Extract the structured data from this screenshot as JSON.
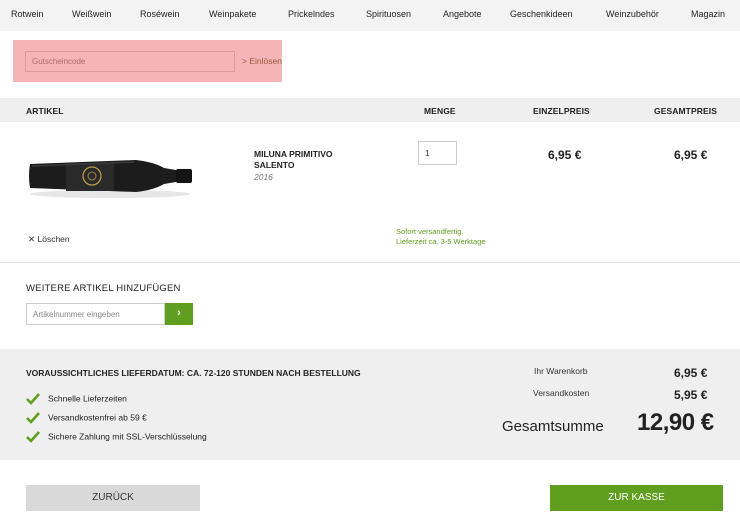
{
  "nav": {
    "items": [
      "Rotwein",
      "Weißwein",
      "Roséwein",
      "Weinpakete",
      "Prickelndes",
      "Spirituosen",
      "Angebote",
      "Geschenkideen",
      "Weinzubehör",
      "Magazin"
    ]
  },
  "voucher": {
    "placeholder": "Gutscheincode",
    "button": "> Einlösen"
  },
  "table": {
    "headers": {
      "article": "ARTIKEL",
      "quantity": "MENGE",
      "unit_price": "EINZELPREIS",
      "total_price": "GESAMTPREIS"
    }
  },
  "cart_item": {
    "name": "MILUNA PRIMITIVO SALENTO",
    "year": "2016",
    "quantity": "1",
    "unit_price": "6,95 €",
    "total_price": "6,95 €",
    "delete": "✕ Löschen",
    "ship_line1": "Sofort versandfertig.",
    "ship_line2": "Lieferzeit ca. 3-5 Werktage"
  },
  "add_article": {
    "title": "WEITERE ARTIKEL HINZUFÜGEN",
    "placeholder": "Artikelnummer eingeben",
    "button": "›"
  },
  "summary": {
    "delivery": "VORAUSSICHTLICHES LIEFERDATUM: CA. 72-120 STUNDEN NACH BESTELLUNG",
    "features": [
      "Schnelle Lieferzeiten",
      "Versandkostenfrei ab 59 €",
      "Sichere Zahlung mit SSL-Verschlüsselung"
    ],
    "cart_label": "Ihr Warenkorb",
    "cart_value": "6,95 €",
    "shipping_label": "Versandkosten",
    "shipping_value": "5,95 €",
    "total_label": "Gesamtsumme",
    "total_value": "12,90 €"
  },
  "buttons": {
    "back": "ZURÜCK",
    "checkout": "ZUR KASSE"
  },
  "colors": {
    "accent_green": "#5f9e1e",
    "voucher_bg": "#f4b4b8",
    "panel_gray": "#efefef"
  }
}
